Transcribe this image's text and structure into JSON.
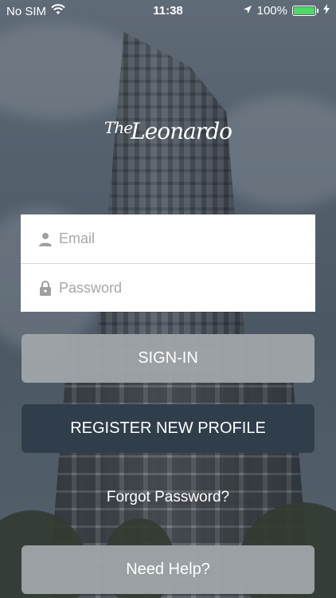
{
  "status_bar": {
    "carrier": "No SIM",
    "time": "11:38",
    "battery_percent": "100%",
    "battery_level": 1.0,
    "icons": [
      "wifi-icon",
      "location-arrow-icon",
      "battery-icon",
      "charging-bolt-icon"
    ]
  },
  "logo": {
    "line1": "The",
    "line2": "Leonardo"
  },
  "login_form": {
    "email_placeholder": "Email",
    "email_value": "",
    "password_placeholder": "Password",
    "password_value": "",
    "email_icon": "user-icon",
    "password_icon": "lock-icon"
  },
  "buttons": {
    "signin_label": "SIGN-IN",
    "register_label": "REGISTER NEW PROFILE",
    "forgot_label": "Forgot Password?",
    "help_label": "Need Help?"
  },
  "colors": {
    "register_bg": "#303e4c",
    "secondary_btn_bg": "#a0a5aa",
    "battery_green": "#4cd964",
    "icon_gray": "#a0a0a0"
  }
}
